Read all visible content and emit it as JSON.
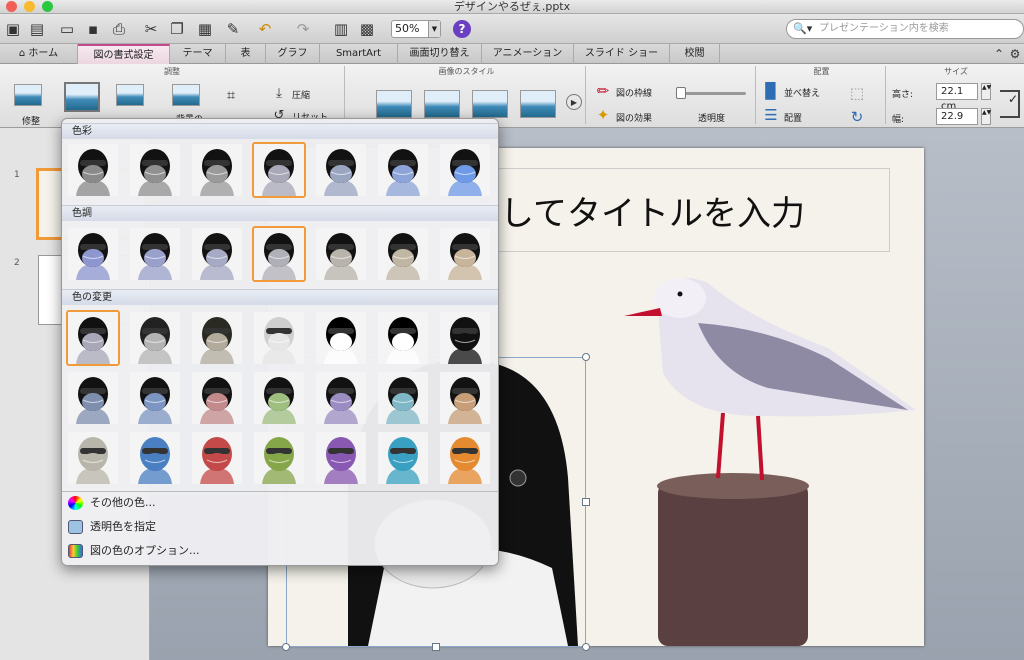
{
  "window": {
    "title": "デザインやるぜぇ.pptx"
  },
  "toolbar": {
    "zoom": "50%",
    "search_placeholder": "プレゼンテーション内を検索"
  },
  "tabs": [
    "ホーム",
    "図の書式設定",
    "テーマ",
    "表",
    "グラフ",
    "SmartArt",
    "画面切り替え",
    "アニメーション",
    "スライド ショー",
    "校閲"
  ],
  "ribbon": {
    "groups": {
      "adjust": "調整",
      "picture_styles": "画像のスタイル",
      "arrange": "配置",
      "size": "サイズ"
    },
    "corrections": "修整",
    "background_removal": "背景の",
    "compress": "圧縮",
    "reset": "リセット",
    "border": "図の枠線",
    "effects": "図の効果",
    "transparency": "透明度",
    "reorder": "並べ替え",
    "align": "配置",
    "height_label": "高さ:",
    "height_value": "22.1 cm",
    "width_label": "幅:",
    "width_value": "22.9 cm"
  },
  "slides": {
    "numbers": [
      "1",
      "2"
    ],
    "title_text": "してタイトルを入力"
  },
  "color_menu": {
    "sections": {
      "saturation": "色彩",
      "tone": "色調",
      "recolor": "色の変更"
    },
    "options": {
      "more_colors": "その他の色...",
      "set_transparent": "透明色を指定",
      "color_options": "図の色のオプション..."
    },
    "saturation_tints": [
      "#8a8a8a",
      "#909090",
      "#9a9a9a",
      "#a8a8b8",
      "#9aa6c0",
      "#8da4d8",
      "#6f9ae8"
    ],
    "tone_tints": [
      "#8e96d0",
      "#9aa0cc",
      "#a6aac4",
      "#b0b0b8",
      "#b8b4ac",
      "#c0b6a4",
      "#c8b49a"
    ],
    "recolor_row1": [
      "#a8a8b8",
      "#b4b4b4",
      "#b2ab9c",
      "#e6e6e6",
      "#ffffff",
      "#ffffff",
      "#111111"
    ],
    "recolor_row2": [
      "#7e8fae",
      "#7d95c2",
      "#c28a8a",
      "#9fbf80",
      "#9b8cc2",
      "#7fb7c7",
      "#c79e77"
    ],
    "recolor_row3": [
      "#b8b6aa",
      "#4a7fc2",
      "#c44a4a",
      "#86a64a",
      "#8858b2",
      "#3aa0c2",
      "#e58a30"
    ],
    "selected": {
      "saturation": 3,
      "tone": 3,
      "recolor": 0
    }
  },
  "picture": {
    "size_readout": ""
  }
}
